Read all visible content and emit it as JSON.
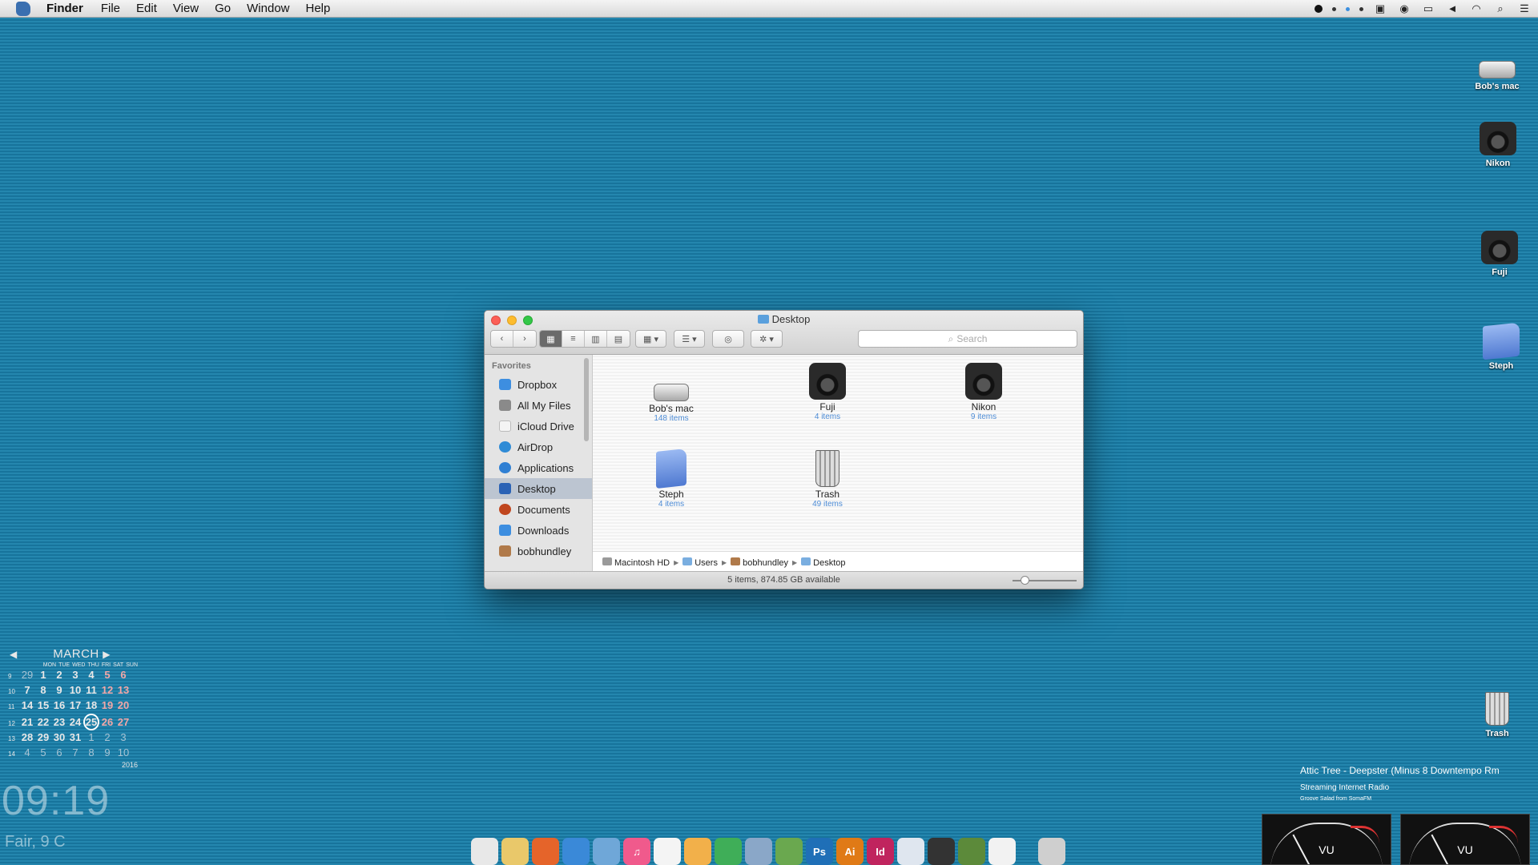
{
  "menubar": {
    "app": "Finder",
    "menus": [
      "File",
      "Edit",
      "View",
      "Go",
      "Window",
      "Help"
    ]
  },
  "desktop_icons": [
    {
      "label": "Bob's mac",
      "icon": "hard-drive-icon"
    },
    {
      "label": "Nikon",
      "icon": "camera-icon"
    },
    {
      "label": "Fuji",
      "icon": "camera-icon"
    },
    {
      "label": "Steph",
      "icon": "folder-icon"
    },
    {
      "label": "Trash",
      "icon": "trash-icon"
    }
  ],
  "finder": {
    "title": "Desktop",
    "search_placeholder": "Search",
    "sidebar_heading": "Favorites",
    "sidebar": [
      {
        "label": "Dropbox",
        "color": "#3d8ee0"
      },
      {
        "label": "All My Files",
        "color": "#8a8a8a"
      },
      {
        "label": "iCloud Drive",
        "color": "#f4f4f4"
      },
      {
        "label": "AirDrop",
        "color": "#2f8bd6"
      },
      {
        "label": "Applications",
        "color": "#2f7fd3"
      },
      {
        "label": "Desktop",
        "color": "#2a62b5",
        "selected": true
      },
      {
        "label": "Documents",
        "color": "#c0461e"
      },
      {
        "label": "Downloads",
        "color": "#3d8ee0"
      },
      {
        "label": "bobhundley",
        "color": "#b07a4a"
      }
    ],
    "items": [
      {
        "name": "Bob's mac",
        "count": "148 items",
        "icon": "hard-drive-icon"
      },
      {
        "name": "Fuji",
        "count": "4 items",
        "icon": "camera-icon"
      },
      {
        "name": "Nikon",
        "count": "9 items",
        "icon": "camera-icon"
      },
      {
        "name": "Steph",
        "count": "4 items",
        "icon": "folder-icon"
      },
      {
        "name": "Trash",
        "count": "49 items",
        "icon": "trash-icon"
      }
    ],
    "path": [
      "Macintosh HD",
      "Users",
      "bobhundley",
      "Desktop"
    ],
    "status": "5 items, 874.85 GB available"
  },
  "calendar": {
    "month": "MARCH",
    "year": "2016",
    "dow": [
      "MON",
      "TUE",
      "WED",
      "THU",
      "FRI",
      "SAT",
      "SUN"
    ],
    "weeks": [
      {
        "wn": "9",
        "days": [
          "29",
          "1",
          "2",
          "3",
          "4",
          "5",
          "6"
        ]
      },
      {
        "wn": "10",
        "days": [
          "7",
          "8",
          "9",
          "10",
          "11",
          "12",
          "13"
        ]
      },
      {
        "wn": "11",
        "days": [
          "14",
          "15",
          "16",
          "17",
          "18",
          "19",
          "20"
        ]
      },
      {
        "wn": "12",
        "days": [
          "21",
          "22",
          "23",
          "24",
          "25",
          "26",
          "27"
        ]
      },
      {
        "wn": "13",
        "days": [
          "28",
          "29",
          "30",
          "31",
          "1",
          "2",
          "3"
        ]
      },
      {
        "wn": "14",
        "days": [
          "4",
          "5",
          "6",
          "7",
          "8",
          "9",
          "10"
        ]
      }
    ],
    "today": "25"
  },
  "clock": "09:19",
  "weather": "Fair, 9 C",
  "radio": {
    "track": "Attic Tree - Deepster (Minus 8 Downtempo Rm",
    "source": "Streaming Internet Radio",
    "station": "Groove Salad from SomaFM",
    "meter_label": "VU"
  },
  "dock": [
    {
      "name": "stormtrooper-icon",
      "color": "#e8e8e8",
      "glyph": ""
    },
    {
      "name": "palette-icon",
      "color": "#e9c86a",
      "glyph": ""
    },
    {
      "name": "firefox-icon",
      "color": "#e5642a",
      "glyph": ""
    },
    {
      "name": "safari-icon",
      "color": "#3a89d8",
      "glyph": ""
    },
    {
      "name": "preview-icon",
      "color": "#6fa7d8",
      "glyph": ""
    },
    {
      "name": "itunes-icon",
      "color": "#f05a8c",
      "glyph": "♫"
    },
    {
      "name": "textedit-icon",
      "color": "#f4f4f4",
      "glyph": ""
    },
    {
      "name": "pages-icon",
      "color": "#f2b04a",
      "glyph": ""
    },
    {
      "name": "numbers-icon",
      "color": "#3fae58",
      "glyph": ""
    },
    {
      "name": "paperclip-icon",
      "color": "#8aa7c8",
      "glyph": ""
    },
    {
      "name": "tree-icon",
      "color": "#6aa84f",
      "glyph": ""
    },
    {
      "name": "photoshop-icon",
      "color": "#1f6fb7",
      "glyph": "Ps"
    },
    {
      "name": "illustrator-icon",
      "color": "#e07a16",
      "glyph": "Ai"
    },
    {
      "name": "indesign-icon",
      "color": "#c0245e",
      "glyph": "Id"
    },
    {
      "name": "finder-window-icon",
      "color": "#dfe6ef",
      "glyph": ""
    },
    {
      "name": "vinyl-icon",
      "color": "#333333",
      "glyph": ""
    },
    {
      "name": "minecraft-icon",
      "color": "#5c8a3a",
      "glyph": ""
    },
    {
      "name": "clock-icon",
      "color": "#f2f2f2",
      "glyph": ""
    },
    {
      "name": "trash-icon",
      "color": "#cfcfcf",
      "glyph": ""
    }
  ]
}
